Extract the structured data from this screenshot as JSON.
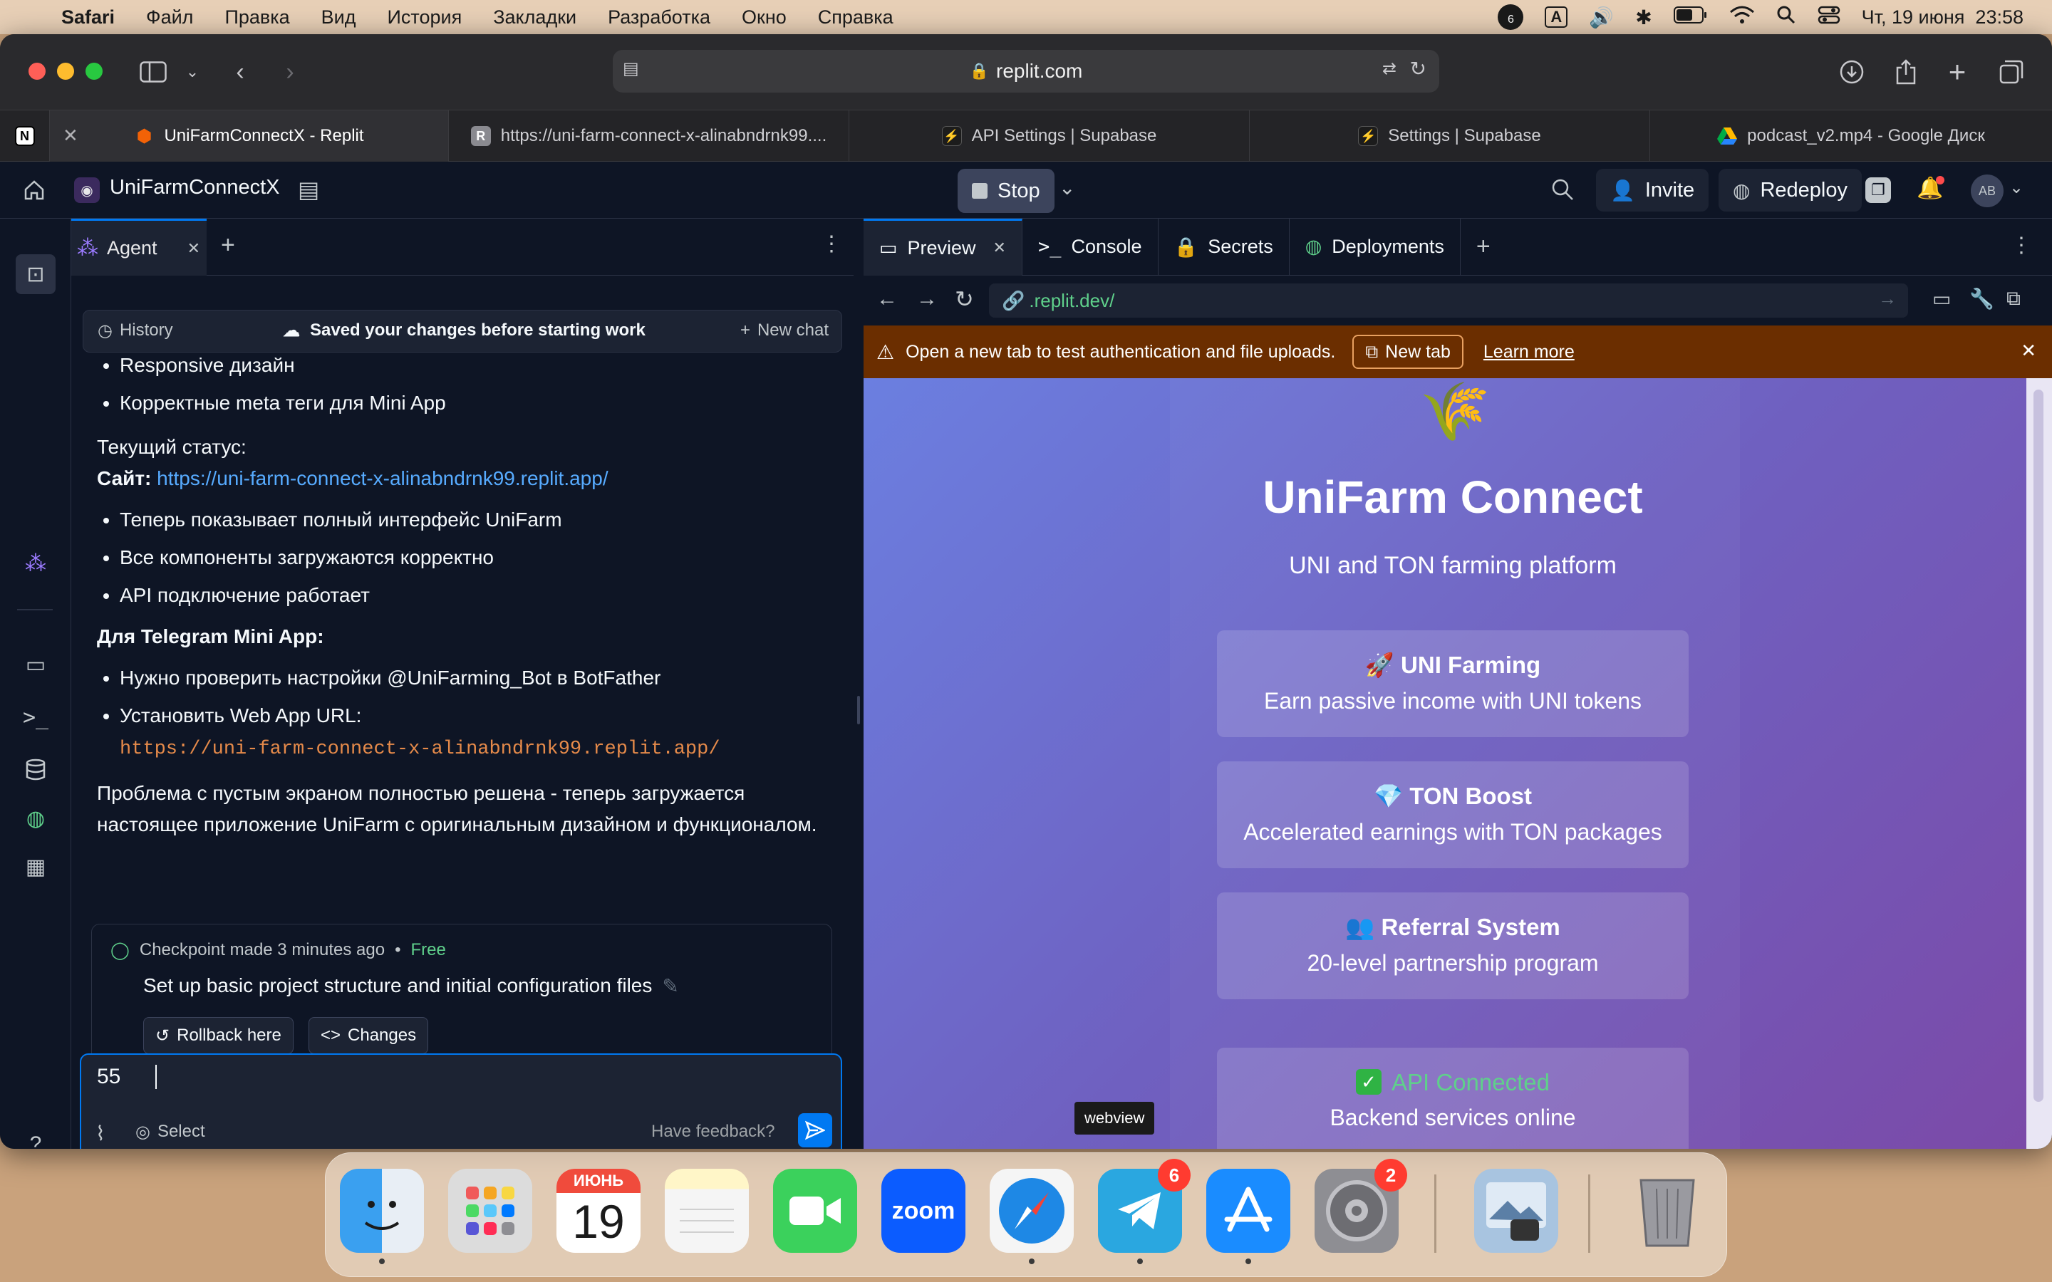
{
  "menubar": {
    "apple": "",
    "app": "Safari",
    "items": [
      "Файл",
      "Правка",
      "Вид",
      "История",
      "Закладки",
      "Разработка",
      "Окно",
      "Справка"
    ],
    "clock": "Чт, 19 июня  23:58",
    "badge_count": "6",
    "input_source": "A"
  },
  "browser": {
    "address": "replit.com",
    "tabs": [
      {
        "label": "UniFarmConnectX - Replit",
        "active": true
      },
      {
        "label": "https://uni-farm-connect-x-alinabndrnk99....",
        "active": false
      },
      {
        "label": "API Settings | Supabase",
        "active": false
      },
      {
        "label": "Settings | Supabase",
        "active": false
      },
      {
        "label": "podcast_v2.mp4 - Google Диск",
        "active": false
      }
    ]
  },
  "replit": {
    "project_name": "UniFarmConnectX",
    "stop_label": "Stop",
    "invite_label": "Invite",
    "redeploy_label": "Redeploy",
    "avatar": "AB"
  },
  "agent": {
    "tab_label": "Agent",
    "history_label": "History",
    "saved_status": "Saved your changes before starting work",
    "new_chat_label": "New chat",
    "messages": {
      "bullet_a": "Responsive дизайн",
      "bullet_b": "Корректные meta теги для Mini App",
      "status_heading": "Текущий статус:",
      "site_label": "Сайт:",
      "site_url": "https://uni-farm-connect-x-alinabndrnk99.replit.app/",
      "bullet_c": "Теперь показывает полный интерфейс UniFarm",
      "bullet_d": "Все компоненты загружаются корректно",
      "bullet_e": "API подключение работает",
      "telegram_heading": "Для Telegram Mini App:",
      "bullet_f": "Нужно проверить настройки @UniFarming_Bot в BotFather",
      "bullet_g": "Установить Web App URL:",
      "webapp_url": "https://uni-farm-connect-x-alinabndrnk99.replit.app/",
      "summary": "Проблема с пустым экраном полностью решена - теперь загружается настоящее приложение UniFarm с оригинальным дизайном и функционалом."
    },
    "checkpoint": {
      "made": "Checkpoint made 3 minutes ago",
      "separator": "•",
      "tier": "Free",
      "description": "Set up basic project structure and initial configuration files",
      "rollback_label": "Rollback here",
      "changes_label": "Changes"
    },
    "input": {
      "value": "55",
      "select_label": "Select",
      "feedback_label": "Have feedback?"
    }
  },
  "preview": {
    "tabs": [
      "Preview",
      "Console",
      "Secrets",
      "Deployments"
    ],
    "url": ".replit.dev/",
    "warning": "Open a new tab to test authentication and file uploads.",
    "new_tab_label": "New tab",
    "learn_more_label": "Learn more",
    "tooltip": "webview"
  },
  "site": {
    "title": "UniFarm Connect",
    "subtitle": "UNI and TON farming platform",
    "cards": [
      {
        "emoji": "🚀",
        "title": "UNI Farming",
        "desc": "Earn passive income with UNI tokens"
      },
      {
        "emoji": "💎",
        "title": "TON Boost",
        "desc": "Accelerated earnings with TON packages"
      },
      {
        "emoji": "👥",
        "title": "Referral System",
        "desc": "20-level partnership program"
      }
    ],
    "api_status": "API Connected",
    "api_desc": "Backend services online"
  },
  "dock": {
    "calendar_month": "ИЮНЬ",
    "calendar_day": "19",
    "zoom_label": "zoom",
    "telegram_badge": "6",
    "settings_badge": "2"
  },
  "colors": {
    "replit_bg": "#0e1525",
    "accent_blue": "#0079f2",
    "warning_bg": "#6b2e00",
    "site_gradient_start": "#6b7fe0",
    "site_gradient_end": "#7b4aa8"
  }
}
